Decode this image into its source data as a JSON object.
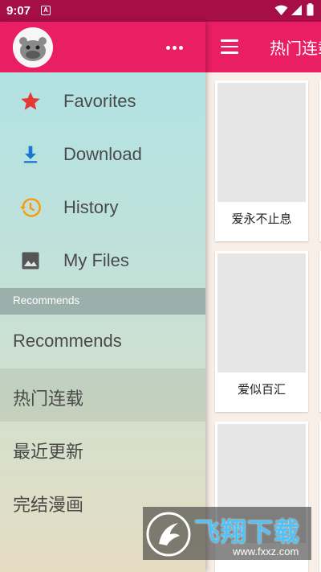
{
  "status_bar": {
    "time": "9:07",
    "notification_letter": "A"
  },
  "app_bar": {
    "title": "热门连载"
  },
  "drawer": {
    "nav_items": [
      {
        "label": "Favorites",
        "icon": "star-icon"
      },
      {
        "label": "Download",
        "icon": "download-icon"
      },
      {
        "label": "History",
        "icon": "history-icon"
      },
      {
        "label": "My Files",
        "icon": "image-icon"
      }
    ],
    "section_header": "Recommends",
    "categories": [
      {
        "label": "Recommends"
      },
      {
        "label": "热门连载",
        "selected": true
      },
      {
        "label": "最近更新"
      },
      {
        "label": "完结漫画"
      }
    ]
  },
  "cards": [
    {
      "title": "爱永不止息"
    },
    {
      "title": "爱似百汇"
    },
    {
      "title": ""
    }
  ],
  "watermark": {
    "brand": "飞翔下载",
    "url": "www.fxxz.com"
  },
  "colors": {
    "primary": "#e91e63",
    "status_bar": "#a60f45",
    "favorites": "#e53935",
    "download": "#1976d2",
    "history": "#ff9800",
    "my_files": "#555555"
  }
}
